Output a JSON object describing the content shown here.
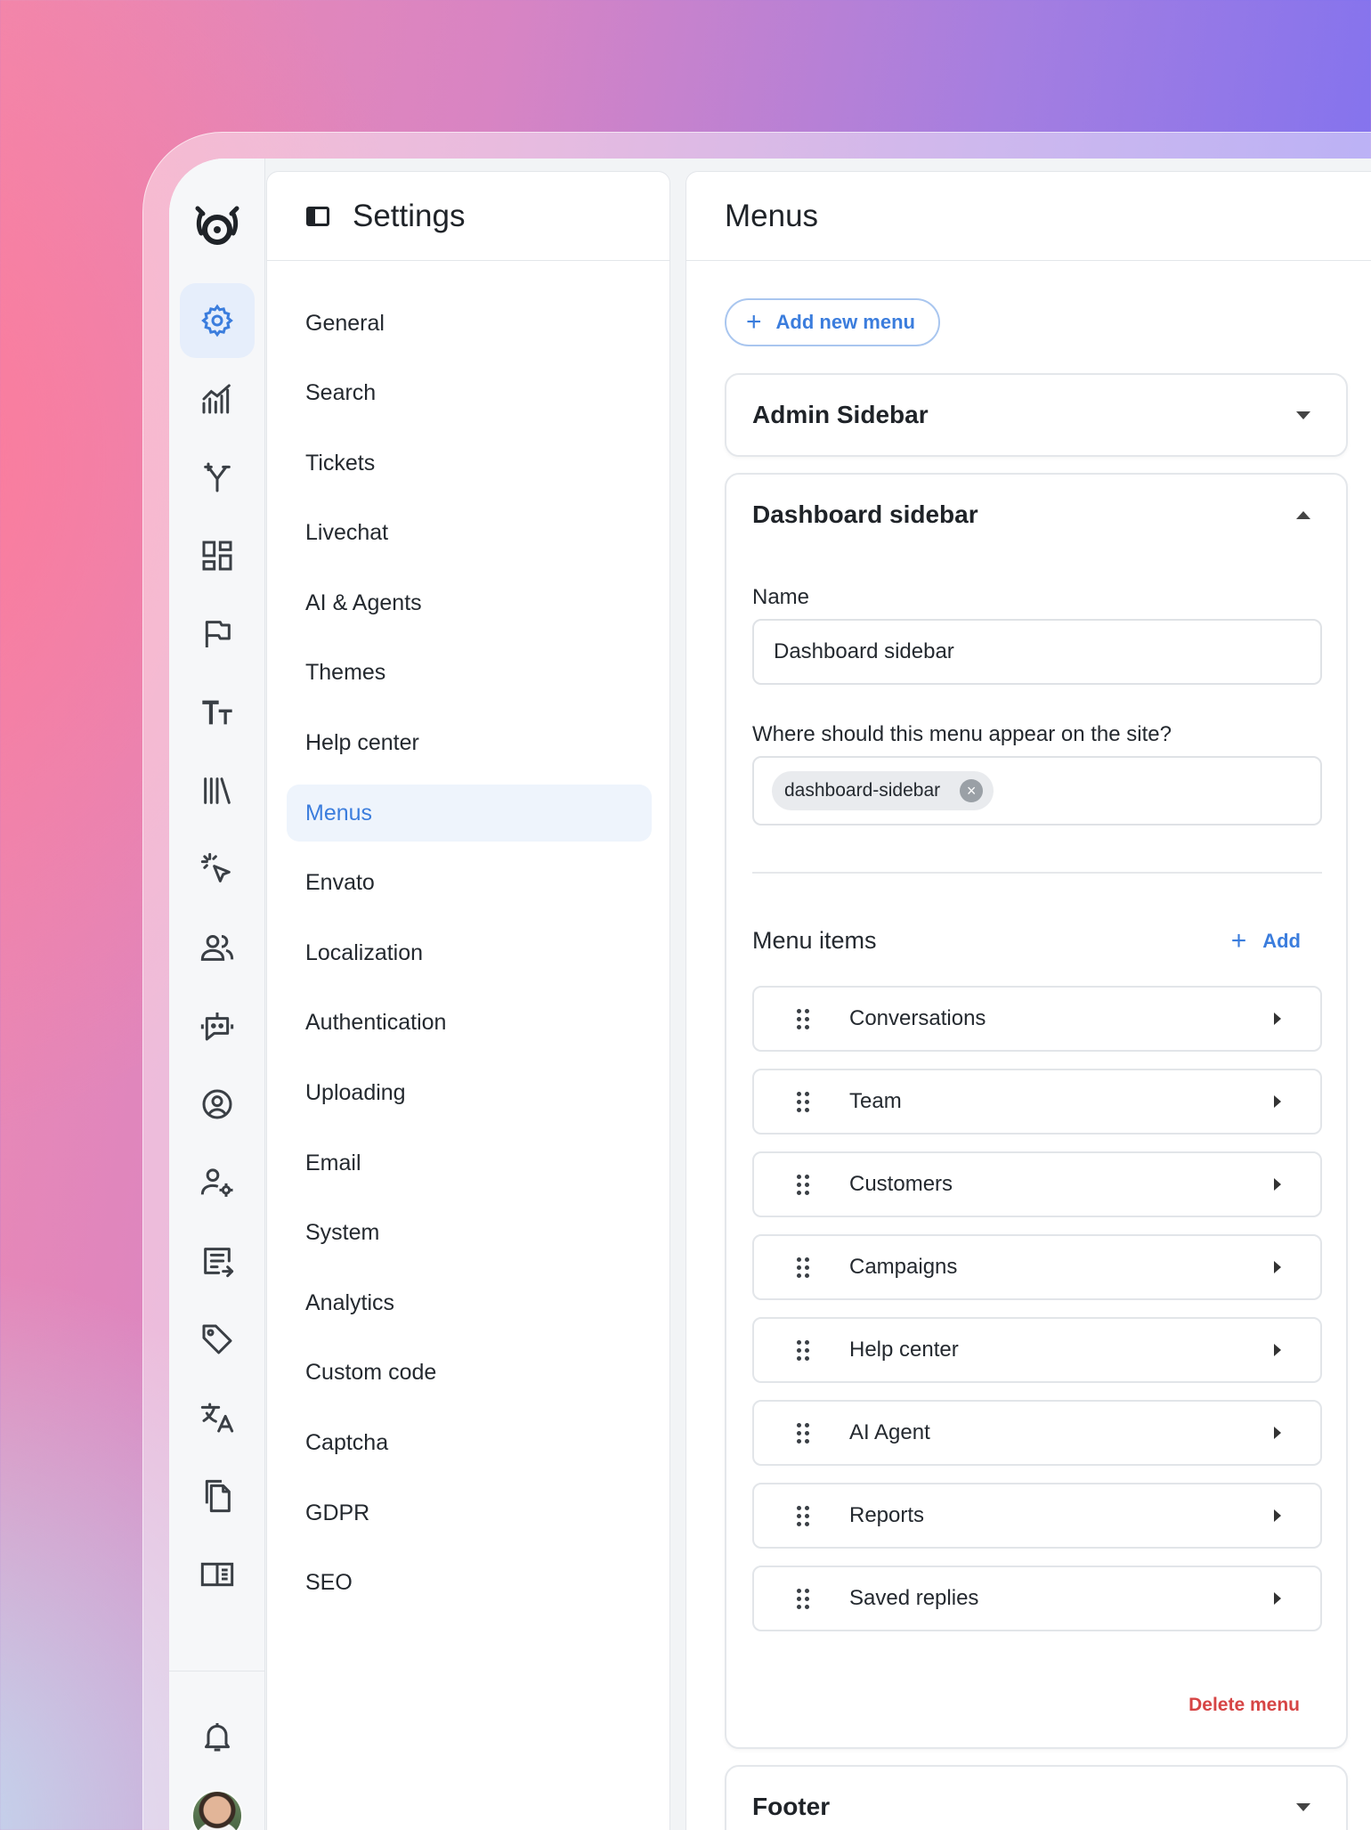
{
  "rail": {
    "icons": [
      "settings-icon",
      "analytics-icon",
      "branch-icon",
      "dashboard-icon",
      "flag-icon",
      "typography-icon",
      "library-icon",
      "click-icon",
      "users-icon",
      "bot-icon",
      "account-circle-icon",
      "user-settings-icon",
      "review-icon",
      "tag-icon",
      "translate-icon",
      "copy-icon",
      "reader-icon"
    ],
    "bottom_icons": [
      "bell-icon",
      "avatar"
    ],
    "accent": "#3b7ddd"
  },
  "settings": {
    "title": "Settings",
    "nav": [
      {
        "label": "General"
      },
      {
        "label": "Search"
      },
      {
        "label": "Tickets"
      },
      {
        "label": "Livechat"
      },
      {
        "label": "AI & Agents"
      },
      {
        "label": "Themes"
      },
      {
        "label": "Help center"
      },
      {
        "label": "Menus",
        "active": true
      },
      {
        "label": "Envato"
      },
      {
        "label": "Localization"
      },
      {
        "label": "Authentication"
      },
      {
        "label": "Uploading"
      },
      {
        "label": "Email"
      },
      {
        "label": "System"
      },
      {
        "label": "Analytics"
      },
      {
        "label": "Custom code"
      },
      {
        "label": "Captcha"
      },
      {
        "label": "GDPR"
      },
      {
        "label": "SEO"
      }
    ]
  },
  "menus": {
    "title": "Menus",
    "add_menu_label": "Add new menu",
    "admin_sidebar": {
      "title": "Admin Sidebar",
      "expanded": false
    },
    "dashboard_sidebar": {
      "title": "Dashboard sidebar",
      "expanded": true,
      "name_label": "Name",
      "name_value": "Dashboard sidebar",
      "position_label": "Where should this menu appear on the site?",
      "position_chip": "dashboard-sidebar",
      "items_title": "Menu items",
      "items_add_label": "Add",
      "items": [
        {
          "label": "Conversations"
        },
        {
          "label": "Team"
        },
        {
          "label": "Customers"
        },
        {
          "label": "Campaigns"
        },
        {
          "label": "Help center"
        },
        {
          "label": "AI Agent"
        },
        {
          "label": "Reports"
        },
        {
          "label": "Saved replies"
        }
      ],
      "delete_label": "Delete menu",
      "delete_color": "#d64545"
    },
    "footer": {
      "title": "Footer",
      "expanded": false
    }
  }
}
